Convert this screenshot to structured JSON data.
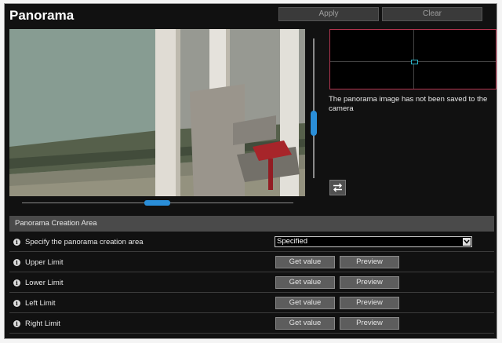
{
  "header": {
    "title": "Panorama",
    "apply_label": "Apply",
    "clear_label": "Clear"
  },
  "panorama_preview": {
    "message": "The panorama image has not been saved to the camera"
  },
  "section": {
    "title": "Panorama Creation Area",
    "area_row": {
      "label": "Specify the panorama creation area",
      "selected": "Specified"
    },
    "limits": [
      {
        "label": "Upper Limit",
        "get_label": "Get value",
        "preview_label": "Preview"
      },
      {
        "label": "Lower Limit",
        "get_label": "Get value",
        "preview_label": "Preview"
      },
      {
        "label": "Left Limit",
        "get_label": "Get value",
        "preview_label": "Preview"
      },
      {
        "label": "Right Limit",
        "get_label": "Get value",
        "preview_label": "Preview"
      }
    ]
  },
  "colors": {
    "accent": "#2a8ed8",
    "panorama_border": "#b5354f",
    "background": "#111111"
  },
  "icons": [
    "info-icon",
    "swap-arrows-icon",
    "chevron-down-icon"
  ]
}
